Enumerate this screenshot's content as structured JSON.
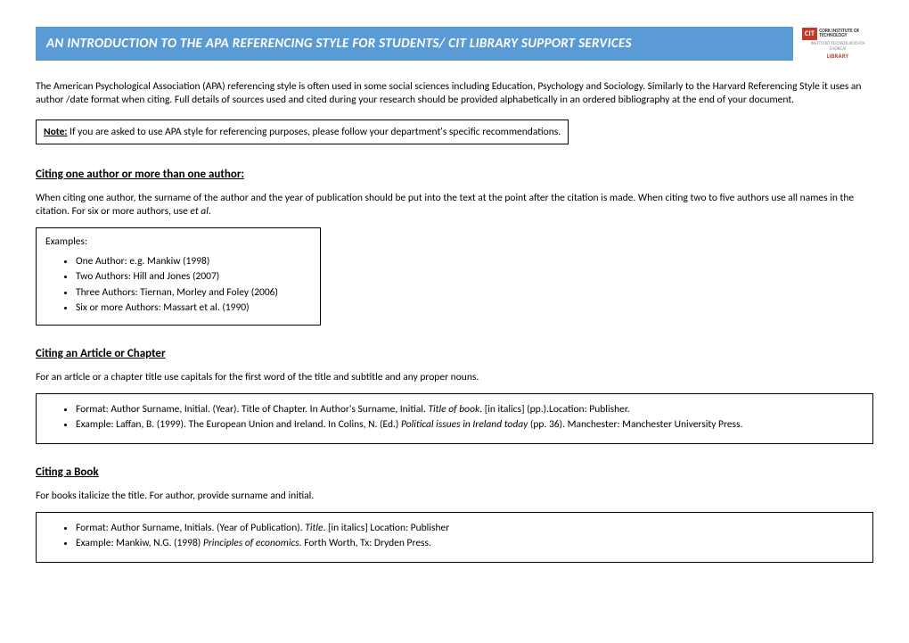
{
  "header": {
    "title": "AN INTRODUCTION TO THE APA REFERENCING STYLE FOR STUDENTS/ CIT LIBRARY SUPPORT SERVICES",
    "logo": {
      "cit": "CIT",
      "name": "CORK\nINSTITUTE OF\nTECHNOLOGY",
      "tag": "INSTITIÚID TEICNEOLAÍOCHTA CHORCAÍ",
      "lib": "LIBRARY"
    }
  },
  "intro": "The American Psychological Association (APA) referencing style is often used in some social sciences including Education, Psychology and Sociology. Similarly to the Harvard Referencing Style it uses an author /date format when citing. Full details of sources used and cited during your research should be provided alphabetically in an ordered bibliography at the end of your document.",
  "note": {
    "label": "Note:",
    "text": " If you are asked to use APA style for referencing purposes, please follow your department's specific recommendations."
  },
  "section1": {
    "heading": "Citing one author or more than one author:",
    "body_pre": "When citing one author, the surname of the author and the year of publication should be put into the text at the point after the citation is made. When citing two to five authors use all names in the citation. For six or more authors, use ",
    "body_it": "et al",
    "body_post": ".",
    "examples_label": "Examples:",
    "examples": [
      "One Author: e.g. Mankiw (1998)",
      "Two Authors: Hill and Jones (2007)",
      "Three Authors: Tiernan, Morley and Foley (2006)",
      "Six or more Authors: Massart et al. (1990)"
    ]
  },
  "section2": {
    "heading": "Citing an Article or Chapter",
    "body": "For an article or a chapter title use capitals for the first word of the title and subtitle and any proper nouns.",
    "format": {
      "pre": "Format:  Author Surname, Initial. (Year). Title of Chapter. In Author's Surname, Initial. ",
      "it": "Title of book",
      "post": ". [in italics] (pp.).Location: Publisher."
    },
    "example": {
      "pre": "Example: Laffan, B. (1999). The European Union and Ireland. In Colins, N. (Ed.) ",
      "it": "Political issues in Ireland today",
      "post": " (pp. 36). Manchester: Manchester University Press."
    }
  },
  "section3": {
    "heading": "Citing a Book",
    "body": "For books italicize the title. For author, provide surname and initial.",
    "format": {
      "pre": "Format: Author Surname, Initials. (Year of Publication). ",
      "it": "Title",
      "post": ". [in italics] Location: Publisher"
    },
    "example": {
      "pre": "Example: Mankiw, N.G. (1998) ",
      "it": "Principles of economics.",
      "post": " Forth Worth, Tx: Dryden Press."
    }
  }
}
